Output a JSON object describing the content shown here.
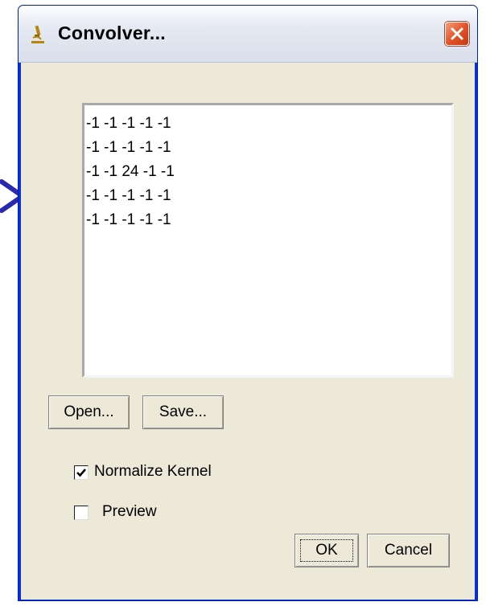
{
  "window": {
    "title": "Convolver...",
    "icon": "microscope-icon"
  },
  "kernel": {
    "lines": [
      "-1 -1 -1 -1 -1",
      "-1 -1 -1 -1 -1",
      "-1 -1 24 -1 -1",
      "-1 -1 -1 -1 -1",
      "-1 -1 -1 -1 -1"
    ]
  },
  "buttons": {
    "open": "Open...",
    "save": "Save...",
    "ok": "OK",
    "cancel": "Cancel"
  },
  "options": {
    "normalize": {
      "label": "Normalize Kernel",
      "checked": true
    },
    "preview": {
      "label": "Preview",
      "checked": false
    }
  },
  "colors": {
    "titlebar_border": "#0831d9",
    "dialog_bg": "#ece9d8",
    "close_button": "#e2542b",
    "annotation_arrow": "#2a2ab0"
  }
}
